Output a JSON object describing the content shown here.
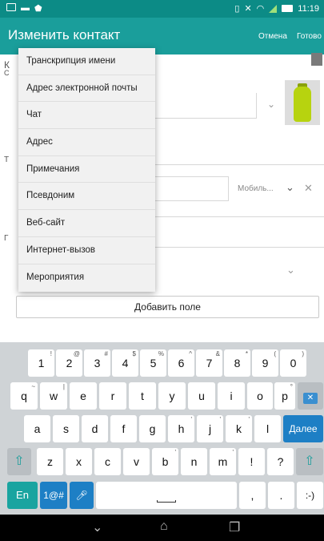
{
  "status_bar": {
    "time": "11:19"
  },
  "app_bar": {
    "title": "Изменить контакт",
    "cancel": "Отмена",
    "done": "Готово"
  },
  "background_form": {
    "partial_letters": [
      "К",
      "С",
      "Т",
      "Г"
    ],
    "mobile_type": "Мобиль...",
    "add_field": "Добавить поле"
  },
  "dropdown_menu": {
    "items": [
      "Транскрипция имени",
      "Адрес электронной почты",
      "Чат",
      "Адрес",
      "Примечания",
      "Псевдоним",
      "Веб-сайт",
      "Интернет-вызов",
      "Мероприятия"
    ]
  },
  "keyboard": {
    "number_row": [
      {
        "main": "1",
        "sub": "!"
      },
      {
        "main": "2",
        "sub": "@"
      },
      {
        "main": "3",
        "sub": "#"
      },
      {
        "main": "4",
        "sub": "$"
      },
      {
        "main": "5",
        "sub": "%"
      },
      {
        "main": "6",
        "sub": "^"
      },
      {
        "main": "7",
        "sub": "&"
      },
      {
        "main": "8",
        "sub": "*"
      },
      {
        "main": "9",
        "sub": "("
      },
      {
        "main": "0",
        "sub": ")"
      }
    ],
    "row1": [
      {
        "main": "q",
        "sub": "~"
      },
      {
        "main": "w",
        "sub": "|"
      },
      {
        "main": "e",
        "sub": ""
      },
      {
        "main": "r",
        "sub": ""
      },
      {
        "main": "t",
        "sub": ""
      },
      {
        "main": "y",
        "sub": ""
      },
      {
        "main": "u",
        "sub": ""
      },
      {
        "main": "i",
        "sub": ""
      },
      {
        "main": "o",
        "sub": ""
      },
      {
        "main": "p",
        "sub": "°"
      }
    ],
    "row2": [
      {
        "main": "a",
        "sub": ""
      },
      {
        "main": "s",
        "sub": ""
      },
      {
        "main": "d",
        "sub": ""
      },
      {
        "main": "f",
        "sub": ""
      },
      {
        "main": "g",
        "sub": ""
      },
      {
        "main": "h",
        "sub": "'"
      },
      {
        "main": "j",
        "sub": "'"
      },
      {
        "main": "k",
        "sub": "'"
      },
      {
        "main": "l",
        "sub": ""
      }
    ],
    "enter_label": "Далее",
    "row3": [
      {
        "main": "z",
        "sub": ""
      },
      {
        "main": "x",
        "sub": ""
      },
      {
        "main": "c",
        "sub": ""
      },
      {
        "main": "v",
        "sub": ""
      },
      {
        "main": "b",
        "sub": "'"
      },
      {
        "main": "n",
        "sub": ""
      },
      {
        "main": "m",
        "sub": "'"
      },
      {
        "main": "!",
        "sub": ""
      },
      {
        "main": "?",
        "sub": ""
      }
    ],
    "lang_label": "En",
    "symbols_label": "1@#",
    "comma": ",",
    "period": ".",
    "smiley": ":-)",
    "shift_icon": "shift-arrow-icon",
    "backspace_icon": "backspace-icon",
    "mic_icon": "microphone-icon"
  },
  "colors": {
    "status_bar": "#0c8b86",
    "app_bar": "#1a9e9b",
    "enter_key": "#1d7fc5",
    "lang_key": "#1aa4a0"
  }
}
